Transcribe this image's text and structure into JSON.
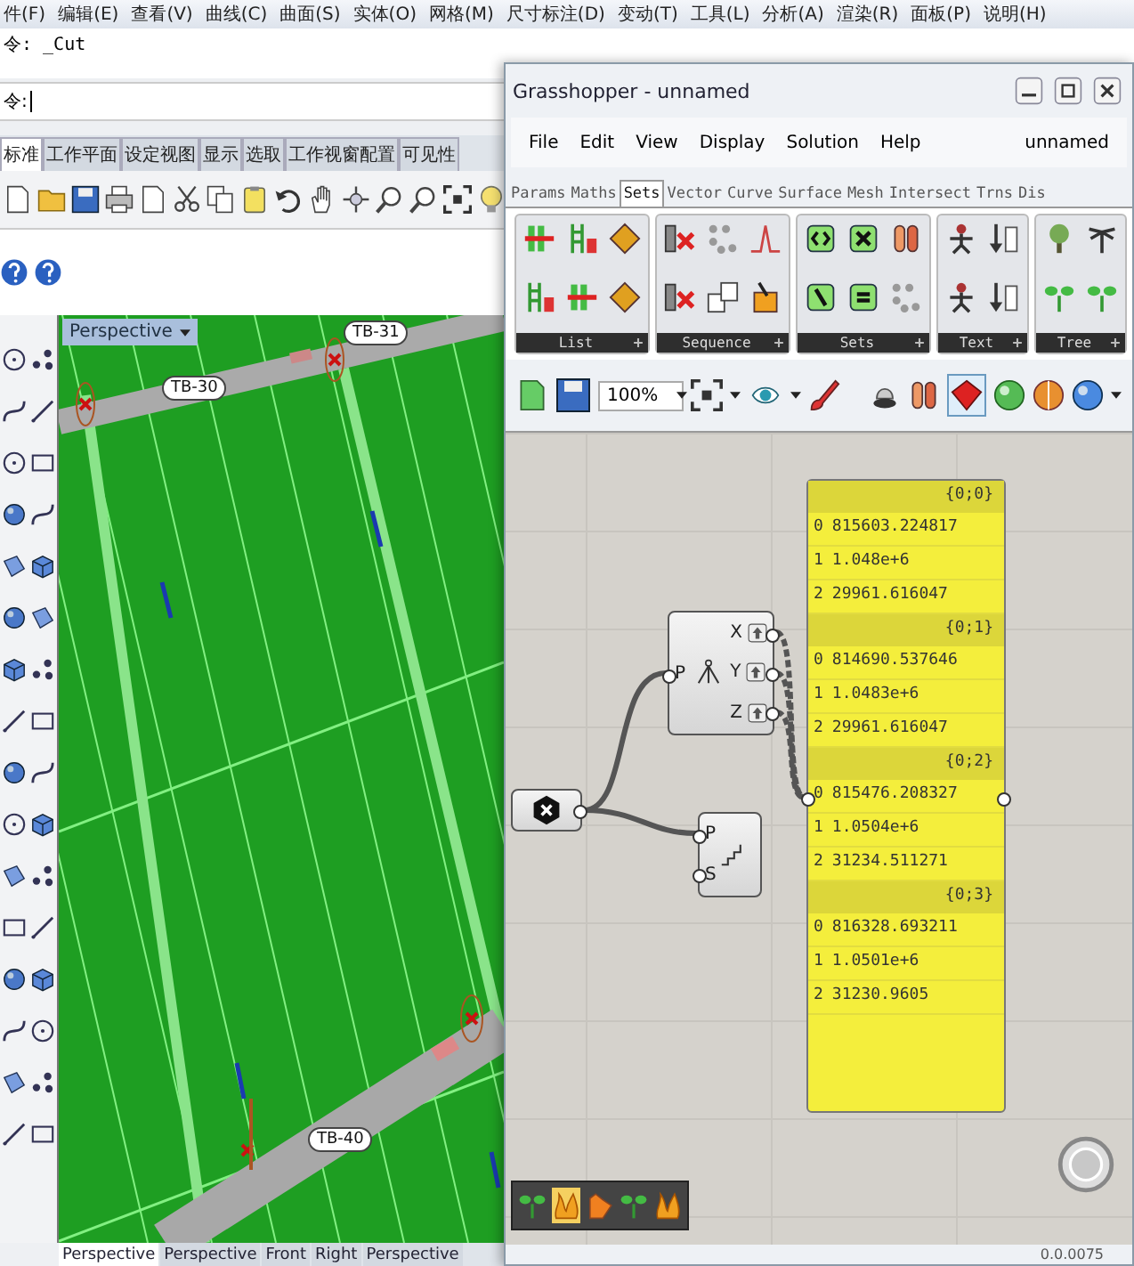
{
  "rhino": {
    "menu": [
      "件(F)",
      "编辑(E)",
      "查看(V)",
      "曲线(C)",
      "曲面(S)",
      "实体(O)",
      "网格(M)",
      "尺寸标注(D)",
      "变动(T)",
      "工具(L)",
      "分析(A)",
      "渲染(R)",
      "面板(P)",
      "说明(H)"
    ],
    "command_history": "令: _Cut",
    "command_prompt": "令:",
    "toolbar_tabs": [
      {
        "label": "标准",
        "selected": true
      },
      {
        "label": "工作平面",
        "selected": false
      },
      {
        "label": "设定视图",
        "selected": false
      },
      {
        "label": "显示",
        "selected": false
      },
      {
        "label": "选取",
        "selected": false
      },
      {
        "label": "工作视窗配置",
        "selected": false
      },
      {
        "label": "可见性",
        "selected": false
      }
    ],
    "viewport": {
      "title": "Perspective",
      "tags": [
        "TB-30",
        "TB-31",
        "TB-40"
      ]
    },
    "viewport_tabs": [
      {
        "label": "Perspective",
        "selected": true
      },
      {
        "label": "Perspective",
        "selected": false
      },
      {
        "label": "Front",
        "selected": false
      },
      {
        "label": "Right",
        "selected": false
      },
      {
        "label": "Perspective",
        "selected": false
      }
    ]
  },
  "grasshopper": {
    "title": "Grasshopper - unnamed",
    "menu": [
      "File",
      "Edit",
      "View",
      "Display",
      "Solution",
      "Help"
    ],
    "document": "unnamed",
    "tabs": [
      {
        "label": "Params",
        "selected": false
      },
      {
        "label": "Maths",
        "selected": false
      },
      {
        "label": "Sets",
        "selected": true
      },
      {
        "label": "Vector",
        "selected": false
      },
      {
        "label": "Curve",
        "selected": false
      },
      {
        "label": "Surface",
        "selected": false
      },
      {
        "label": "Mesh",
        "selected": false
      },
      {
        "label": "Intersect",
        "selected": false
      },
      {
        "label": "Trns",
        "selected": false
      },
      {
        "label": "Dis",
        "selected": false
      }
    ],
    "ribbon_groups": [
      "List",
      "Sequence",
      "Sets",
      "Text",
      "Tree"
    ],
    "zoom": "100%",
    "canvas": {
      "deconstruct": {
        "inputs": [
          "P"
        ],
        "outputs": [
          "X",
          "Y",
          "Z"
        ]
      },
      "component": {
        "inputs": [
          "P",
          "S"
        ]
      },
      "panel": {
        "branches": [
          {
            "path": "{0;0}",
            "items": [
              {
                "index": "0",
                "value": "815603.224817"
              },
              {
                "index": "1",
                "value": "1.048e+6"
              },
              {
                "index": "2",
                "value": "29961.616047"
              }
            ]
          },
          {
            "path": "{0;1}",
            "items": [
              {
                "index": "0",
                "value": "814690.537646"
              },
              {
                "index": "1",
                "value": "1.0483e+6"
              },
              {
                "index": "2",
                "value": "29961.616047"
              }
            ]
          },
          {
            "path": "{0;2}",
            "items": [
              {
                "index": "0",
                "value": "815476.208327"
              },
              {
                "index": "1",
                "value": "1.0504e+6"
              },
              {
                "index": "2",
                "value": "31234.511271"
              }
            ]
          },
          {
            "path": "{0;3}",
            "items": [
              {
                "index": "0",
                "value": "816328.693211"
              },
              {
                "index": "1",
                "value": "1.0501e+6"
              },
              {
                "index": "2",
                "value": "31230.9605"
              }
            ]
          }
        ]
      }
    },
    "status": "0.0.0075"
  }
}
